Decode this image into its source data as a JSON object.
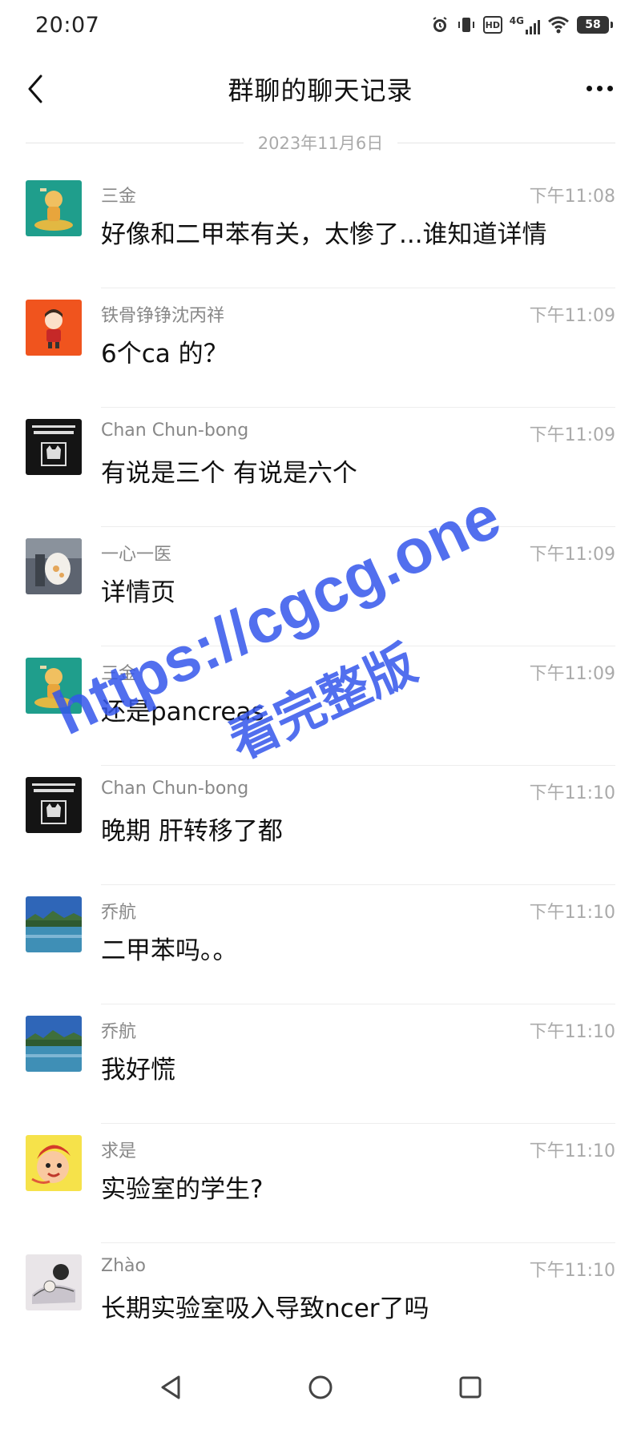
{
  "status": {
    "time": "20:07",
    "battery": "58",
    "hd": "HD",
    "network": "4G"
  },
  "header": {
    "title": "群聊的聊天记录"
  },
  "date_divider": "2023年11月6日",
  "messages": [
    {
      "sender": "三金",
      "time": "下午11:08",
      "text": "好像和二甲苯有关，太惨了...谁知道详情",
      "avatar": "green-astronaut-avatar"
    },
    {
      "sender": "铁骨铮铮沈丙祥",
      "time": "下午11:09",
      "text": "6个ca 的？",
      "avatar": "orange-cartoon-boy-avatar"
    },
    {
      "sender": "Chan Chun-bong",
      "time": "下午11:09",
      "text": "有说是三个 有说是六个",
      "avatar": "dark-cat-logo-avatar"
    },
    {
      "sender": "一心一医",
      "time": "下午11:09",
      "text": "详情页",
      "avatar": "cat-photo-avatar"
    },
    {
      "sender": "三金",
      "time": "下午11:09",
      "text": "还是pancreas",
      "avatar": "green-astronaut-avatar"
    },
    {
      "sender": "Chan Chun-bong",
      "time": "下午11:10",
      "text": "晚期 肝转移了都",
      "avatar": "dark-cat-logo-avatar"
    },
    {
      "sender": "乔航",
      "time": "下午11:10",
      "text": "二甲苯吗。。",
      "avatar": "lake-landscape-avatar"
    },
    {
      "sender": "乔航",
      "time": "下午11:10",
      "text": "我好慌",
      "avatar": "lake-landscape-avatar"
    },
    {
      "sender": "求是",
      "time": "下午11:10",
      "text": "实验室的学生?",
      "avatar": "cartoon-face-avatar"
    },
    {
      "sender": "Zhào",
      "time": "下午11:10",
      "text": "长期实验室吸入导致ncer了吗",
      "avatar": "sketch-drawing-avatar"
    }
  ],
  "watermark": {
    "line1": "https://cgcg.one",
    "line2": "看完整版"
  },
  "colors": {
    "watermark": "#3456eb",
    "sender": "#888888",
    "time": "#aaaaaa",
    "background": "#ffffff"
  }
}
